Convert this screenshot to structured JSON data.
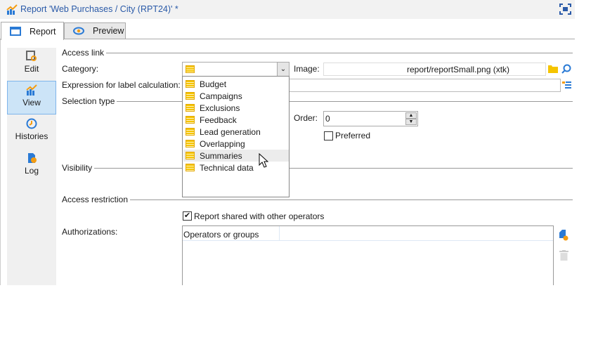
{
  "window": {
    "title": "Report 'Web Purchases / City (RPT24)' *"
  },
  "tabs": [
    {
      "label": "Report",
      "active": true
    },
    {
      "label": "Preview",
      "active": false
    }
  ],
  "sidebar": {
    "items": [
      {
        "label": "Edit"
      },
      {
        "label": "View",
        "selected": true
      },
      {
        "label": "Histories"
      },
      {
        "label": "Log"
      }
    ]
  },
  "access_link": {
    "section": "Access link",
    "category_label": "Category:",
    "category_value": "",
    "image_label": "Image:",
    "image_value": "report/reportSmall.png (xtk)",
    "expression_label": "Expression for label calculation:",
    "expression_value": ""
  },
  "category_options": [
    "Budget",
    "Campaigns",
    "Exclusions",
    "Feedback",
    "Lead generation",
    "Overlapping",
    "Summaries",
    "Technical data"
  ],
  "highlighted_option": "Summaries",
  "selection_type": {
    "section": "Selection type",
    "order_label": "Order:",
    "order_value": "0",
    "preferred_label": "Preferred",
    "preferred_checked": false
  },
  "visibility": {
    "section": "Visibility"
  },
  "access_restriction": {
    "section": "Access restriction",
    "shared_label": "Report shared with other operators",
    "shared_checked": true,
    "authorizations_label": "Authorizations:",
    "table_header": "Operators or groups"
  },
  "colors": {
    "accent": "#2a7ad5",
    "selected_bg": "#cce4f7",
    "category_icon": "#f5c400"
  }
}
